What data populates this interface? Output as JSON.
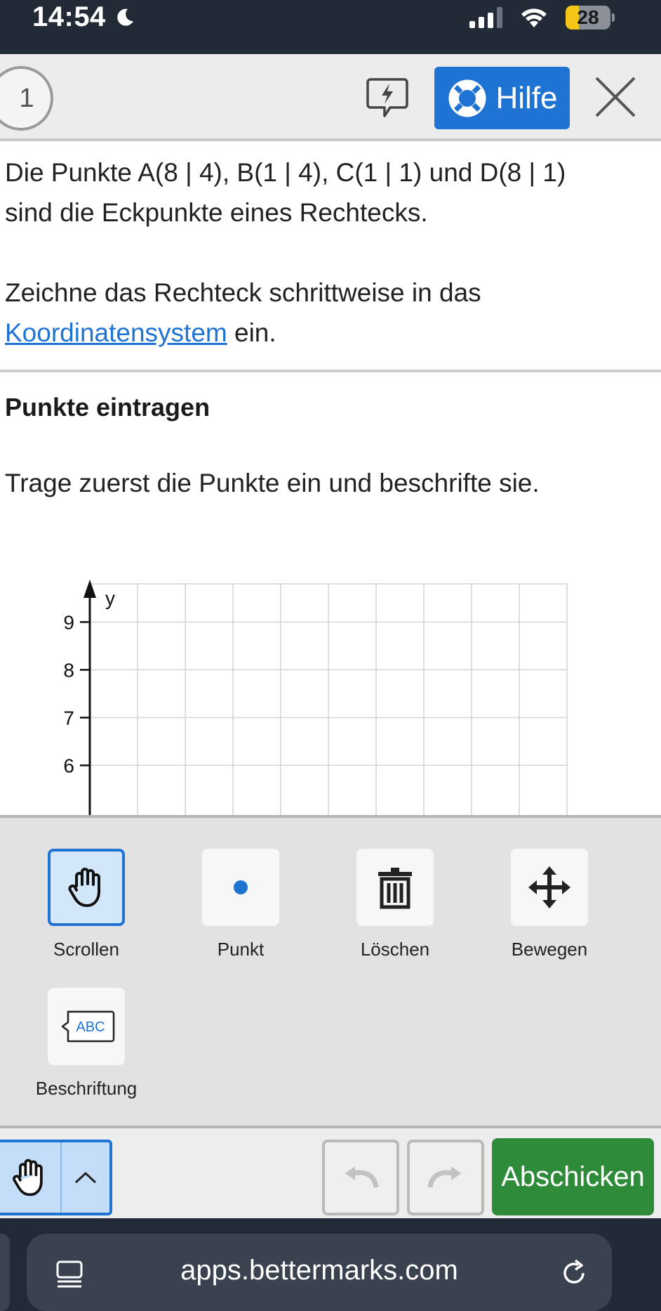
{
  "status_bar": {
    "time": "14:54",
    "battery": "28"
  },
  "header": {
    "step_number": "1",
    "help_label": "Hilfe"
  },
  "task": {
    "line1": "Die Punkte A(8 | 4), B(1 | 4), C(1 | 1) und D(8 | 1)",
    "line2": "sind die Eckpunkte eines Rechtecks.",
    "instruction_prefix": "Zeichne das Rechteck schrittweise in das",
    "link_text": "Koordinatensystem",
    "instruction_suffix": " ein."
  },
  "section": {
    "title": "Punkte eintragen",
    "text": "Trage zuerst die Punkte ein und beschrifte sie."
  },
  "chart_data": {
    "type": "scatter",
    "ylabel": "y",
    "y_ticks": [
      "9",
      "8",
      "7",
      "6"
    ],
    "ylim": [
      5.7,
      9.8
    ],
    "xlim": [
      0,
      10
    ],
    "grid": true,
    "points": []
  },
  "tools": [
    {
      "label": "Scrollen",
      "icon": "hand-icon",
      "selected": true
    },
    {
      "label": "Punkt",
      "icon": "point-icon",
      "selected": false
    },
    {
      "label": "Löschen",
      "icon": "trash-icon",
      "selected": false
    },
    {
      "label": "Bewegen",
      "icon": "move-icon",
      "selected": false
    },
    {
      "label": "Beschriftung",
      "icon": "label-icon",
      "selected": false
    }
  ],
  "bottom_bar": {
    "submit_label": "Abschicken"
  },
  "browser": {
    "url": "apps.bettermarks.com"
  },
  "colors": {
    "accent": "#1f74d3",
    "submit": "#2e8b3a",
    "status_bar": "#222a36"
  }
}
